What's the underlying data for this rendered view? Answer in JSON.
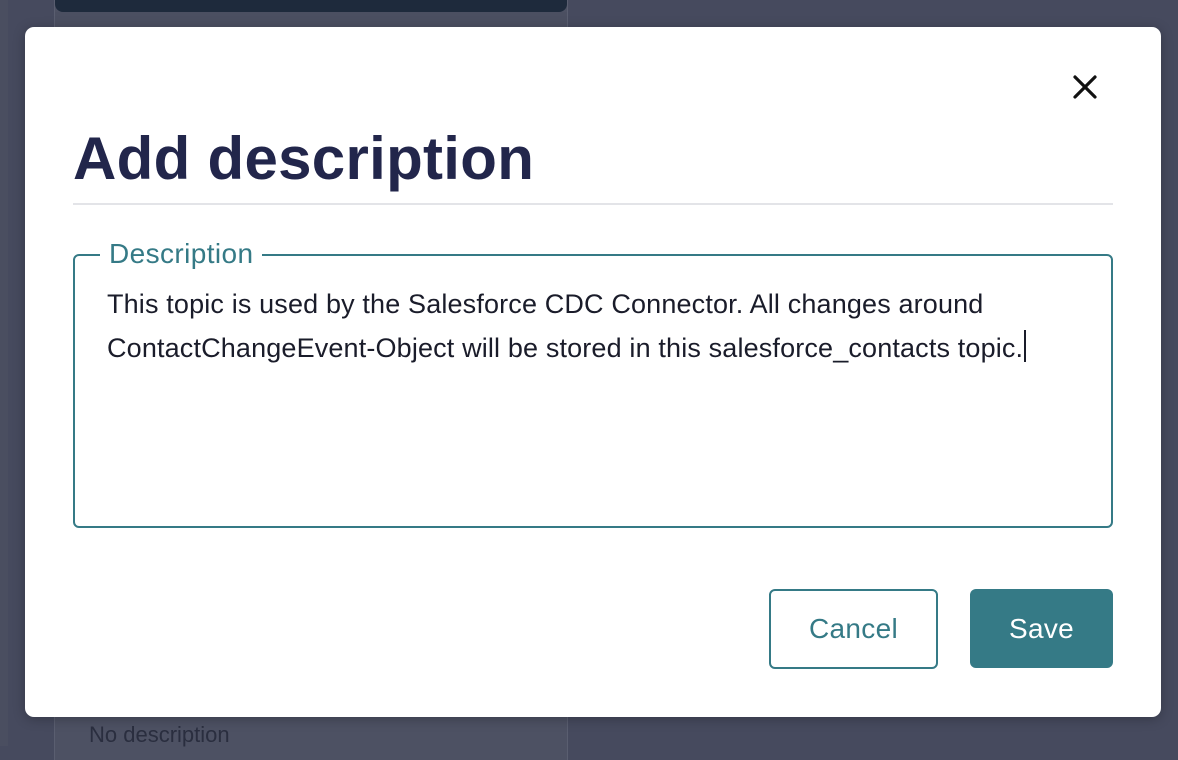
{
  "background": {
    "card_placeholder_text": "No description"
  },
  "modal": {
    "title": "Add description",
    "close_icon": "close-icon",
    "description": {
      "label": "Description",
      "value": "This topic is used by the Salesforce CDC Connector. All changes around ContactChangeEvent-Object will be stored in this salesforce_contacts topic."
    },
    "buttons": {
      "cancel_label": "Cancel",
      "save_label": "Save"
    }
  },
  "colors": {
    "accent": "#357a86",
    "title": "#22264b",
    "overlay": "#464a5e",
    "surface": "#ffffff"
  }
}
